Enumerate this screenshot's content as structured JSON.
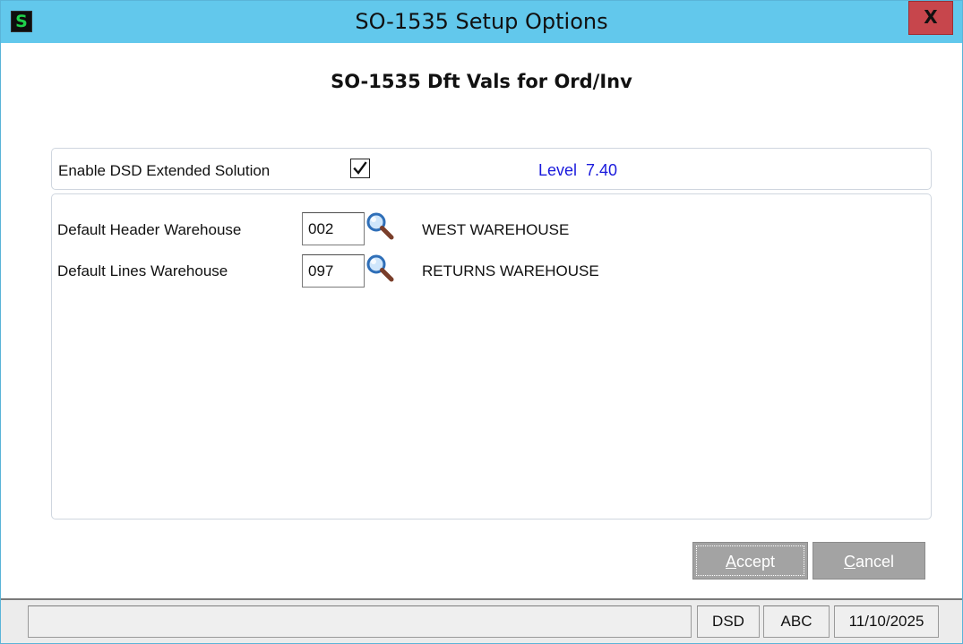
{
  "window": {
    "title": "SO-1535 Setup Options",
    "app_icon_letter": "S",
    "close_label": "X"
  },
  "dialog": {
    "heading": "SO-1535 Dft Vals for Ord/Inv"
  },
  "options": {
    "enable_label": "Enable DSD Extended Solution",
    "enable_checked": true,
    "level_text": "Level  7.40"
  },
  "fields": {
    "header_warehouse": {
      "label": "Default Header Warehouse",
      "value": "002",
      "description": "WEST WAREHOUSE"
    },
    "lines_warehouse": {
      "label": "Default Lines Warehouse",
      "value": "097",
      "description": "RETURNS WAREHOUSE"
    }
  },
  "buttons": {
    "accept_hotkey": "A",
    "accept_rest": "ccept",
    "cancel_hotkey": "C",
    "cancel_rest": "ancel"
  },
  "statusbar": {
    "message": "",
    "company_code": "DSD",
    "user_code": "ABC",
    "date": "11/10/2025"
  },
  "colors": {
    "titlebar": "#62c8ec",
    "close_button": "#c7464c",
    "level_text": "#1a1adc",
    "button_disabled_gray": "#a3a3a3"
  },
  "icons": {
    "app": "sage-s-icon",
    "close": "close-icon",
    "lookup": "magnifier-icon",
    "check": "checkmark-icon"
  }
}
